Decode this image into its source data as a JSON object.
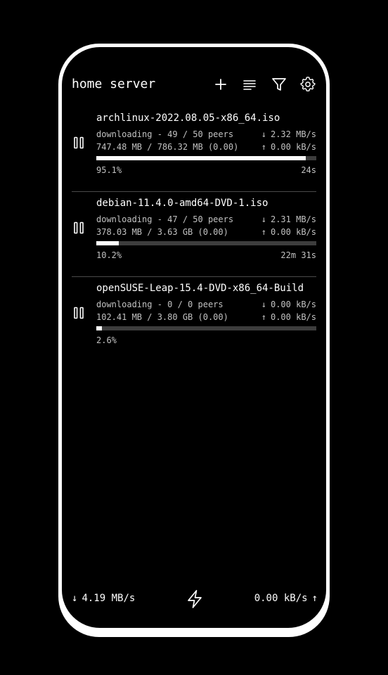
{
  "header": {
    "title": "home server",
    "actions": [
      {
        "icon": "plus-icon"
      },
      {
        "icon": "sort-icon"
      },
      {
        "icon": "filter-icon"
      },
      {
        "icon": "gear-icon"
      }
    ]
  },
  "torrents": [
    {
      "name": "archlinux-2022.08.05-x86_64.iso",
      "status": "downloading - 49 / 50 peers",
      "down_rate": "2.32 MB/s",
      "size": "747.48 MB / 786.32 MB (0.00)",
      "up_rate": "0.00 kB/s",
      "progress": 0.951,
      "percent": "95.1%",
      "eta": "24s"
    },
    {
      "name": "debian-11.4.0-amd64-DVD-1.iso",
      "status": "downloading - 47 / 50 peers",
      "down_rate": "2.31 MB/s",
      "size": "378.03 MB / 3.63 GB (0.00)",
      "up_rate": "0.00 kB/s",
      "progress": 0.102,
      "percent": "10.2%",
      "eta": "22m 31s"
    },
    {
      "name": "openSUSE-Leap-15.4-DVD-x86_64-Build",
      "status": "downloading - 0 / 0 peers",
      "down_rate": "0.00 kB/s",
      "size": "102.41 MB / 3.80 GB (0.00)",
      "up_rate": "0.00 kB/s",
      "progress": 0.026,
      "percent": "2.6%",
      "eta": ""
    }
  ],
  "glyphs": {
    "down_arrow": "↓",
    "up_arrow": "↑"
  },
  "footer": {
    "down_total": "4.19 MB/s",
    "up_total": "0.00 kB/s",
    "center_icon": "lightning-icon"
  },
  "colors": {
    "background": "#000000",
    "frame": "#ffffff",
    "text": "#ffffff",
    "muted_text": "#c2c2c2",
    "progress_track": "#3d3d3d",
    "progress_fill": "#ffffff",
    "divider": "#4a4a4a"
  }
}
